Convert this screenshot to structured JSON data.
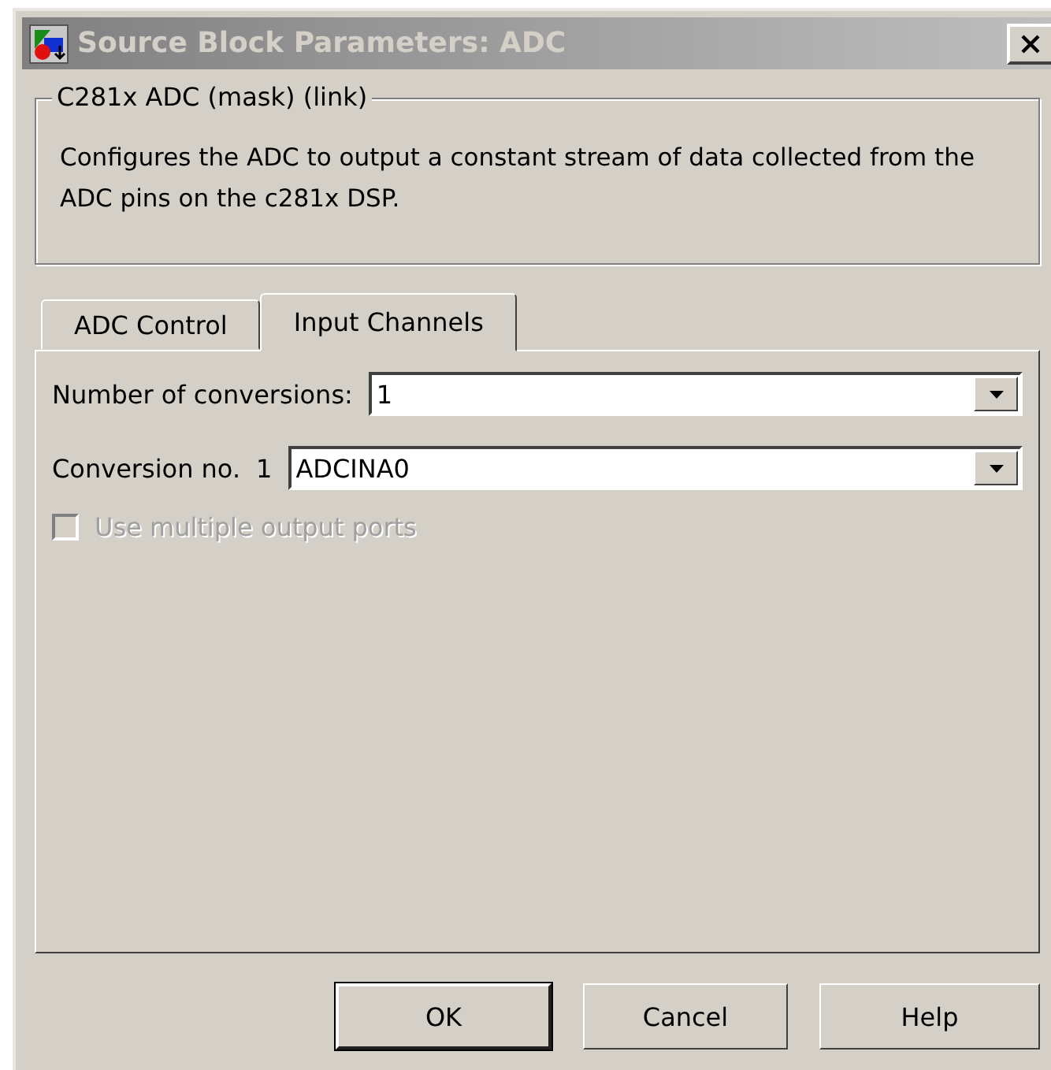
{
  "window": {
    "title": "Source Block Parameters: ADC"
  },
  "group": {
    "title": "C281x ADC (mask) (link)",
    "description": "Configures the ADC to output a constant stream of data collected from the ADC pins on the c281x DSP."
  },
  "tabs": [
    {
      "label": "ADC Control",
      "selected": false
    },
    {
      "label": "Input Channels",
      "selected": true
    }
  ],
  "fields": [
    {
      "label": "Number of conversions:",
      "value": "1"
    },
    {
      "label": "Conversion no.",
      "index": "1",
      "value": "ADCINA0"
    }
  ],
  "checkbox": {
    "label": "Use multiple output ports",
    "checked": false,
    "disabled": true
  },
  "buttons": [
    {
      "label": "OK",
      "default": true
    },
    {
      "label": "Cancel",
      "default": false
    },
    {
      "label": "Help",
      "default": false
    }
  ]
}
